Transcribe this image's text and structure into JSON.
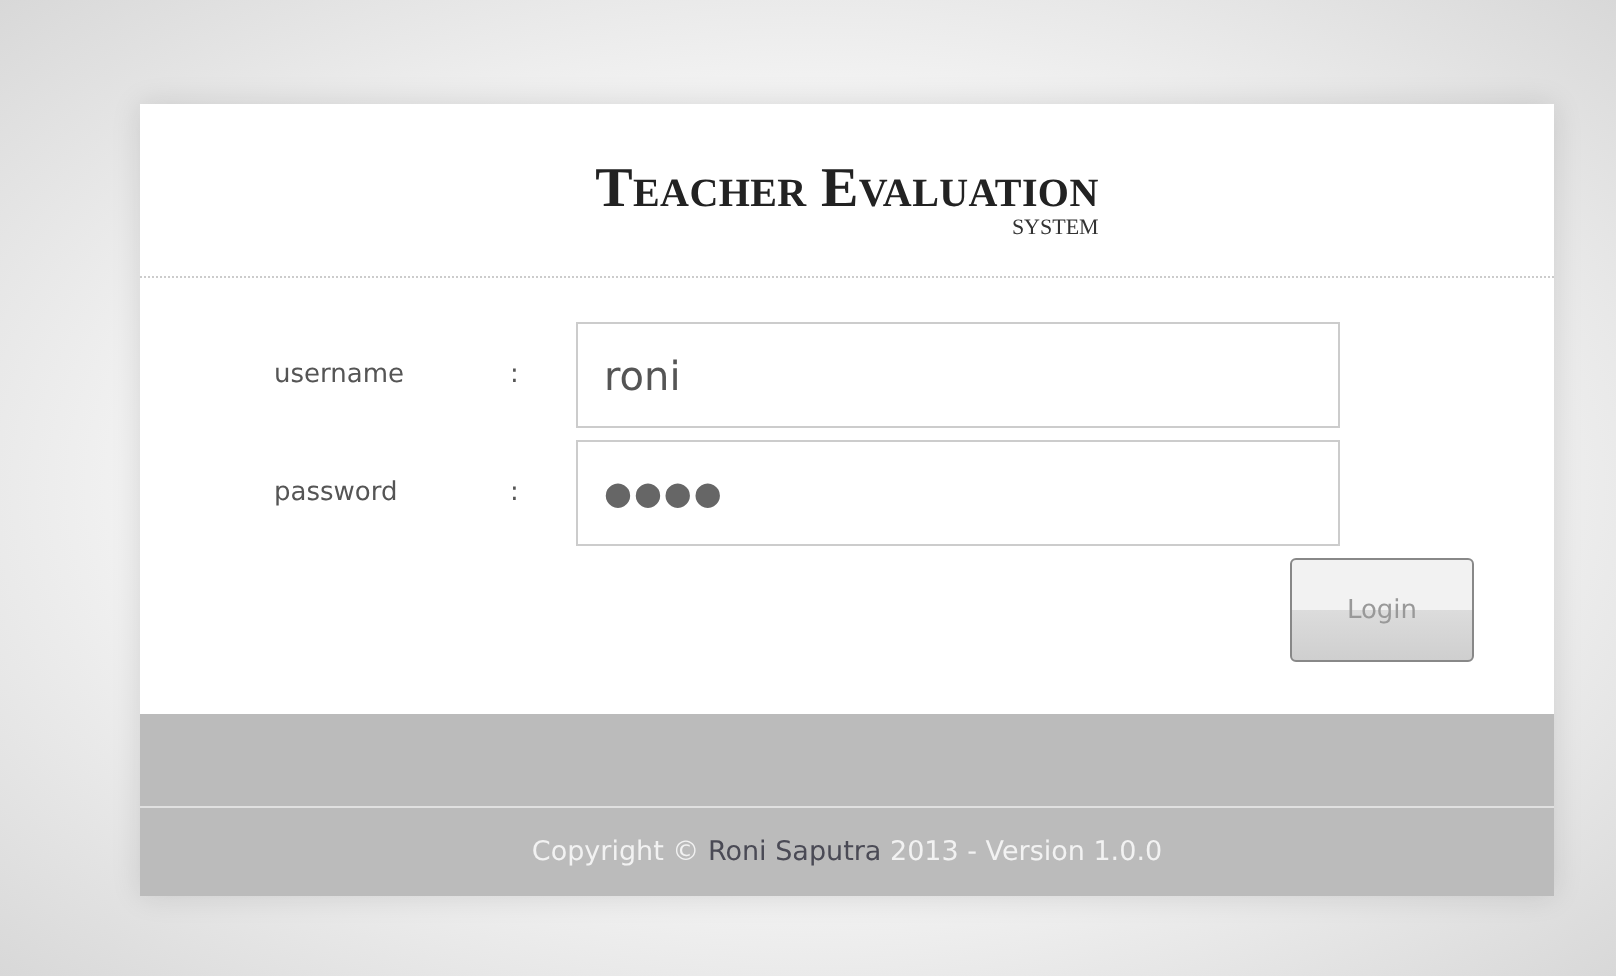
{
  "header": {
    "title": "Teacher Evaluation",
    "subtitle": "SYSTEM"
  },
  "fields": [
    {
      "label": "username",
      "separator": ":",
      "value": "roni"
    },
    {
      "label": "password",
      "separator": ":",
      "value": "●●●●"
    }
  ],
  "login_button": "Login",
  "footer": {
    "before": "Copyright © ",
    "link": "Roni Saputra",
    "after": " 2013 - Version 1.0.0"
  }
}
